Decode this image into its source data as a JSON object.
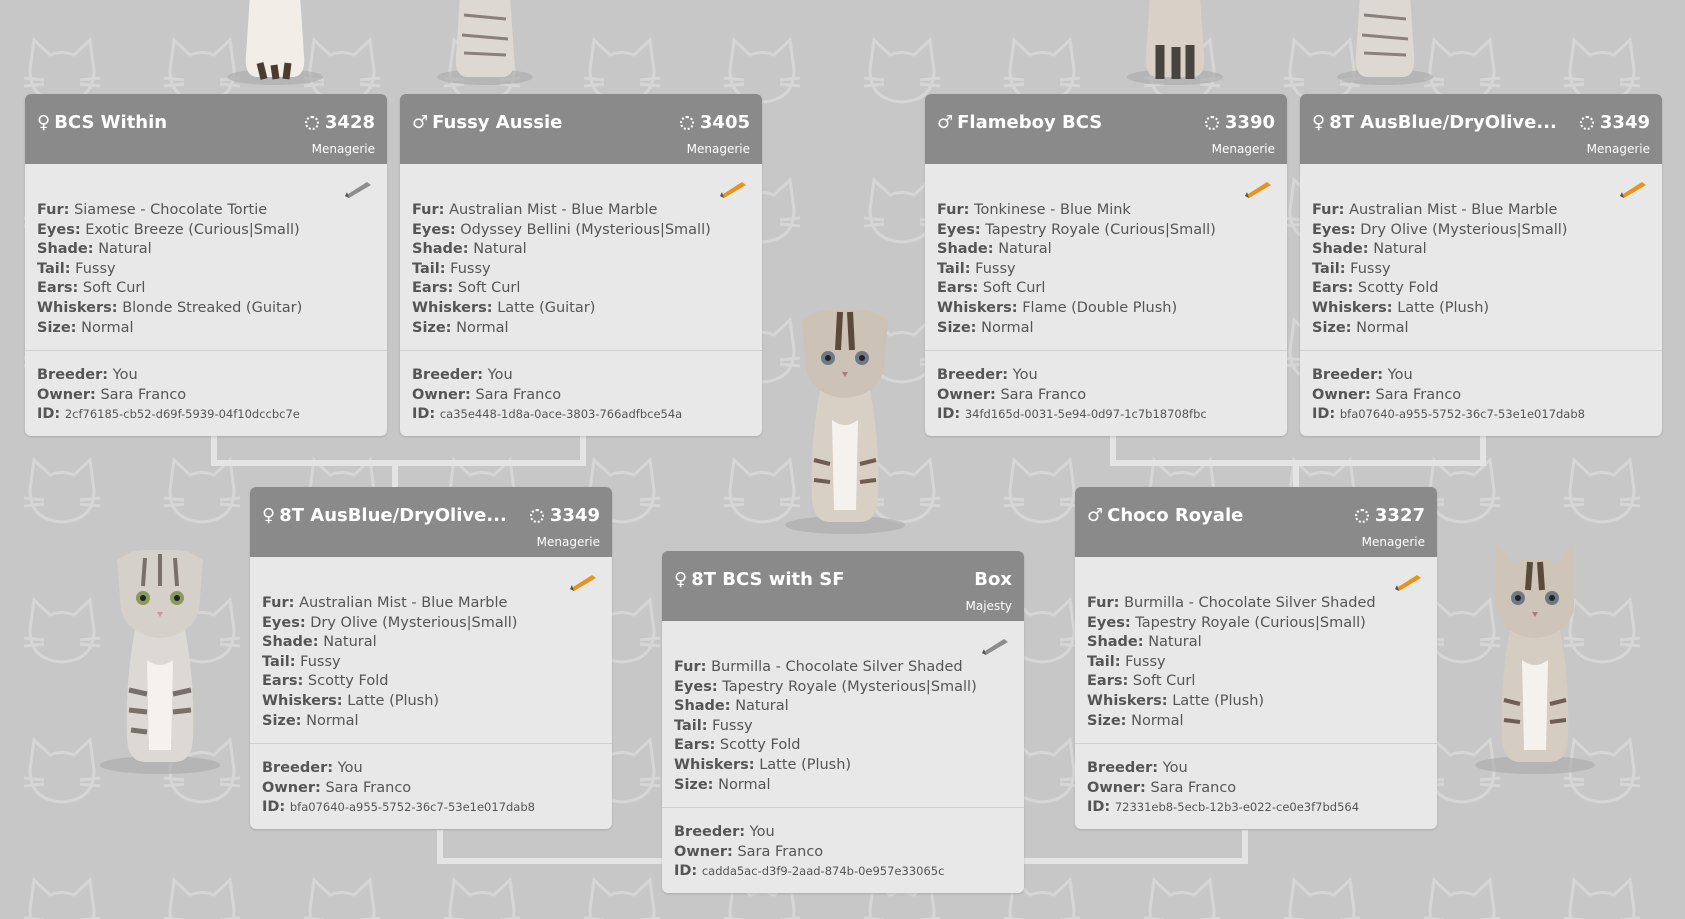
{
  "labels": {
    "fur": "Fur:",
    "eyes": "Eyes:",
    "shade": "Shade:",
    "tail": "Tail:",
    "ears": "Ears:",
    "whiskers": "Whiskers:",
    "size": "Size:",
    "breeder": "Breeder:",
    "owner": "Owner:",
    "id": "ID:"
  },
  "colors": {
    "background": "#c7c7c7",
    "card_header": "#8a8a8a",
    "card_body": "#e8e8e8",
    "pencil_orange": "#e8941a",
    "pencil_gray": "#8d8d8d"
  },
  "cats": [
    {
      "gender": "♀",
      "name": "BCS Within",
      "generation": "3428",
      "tag": "Menagerie",
      "fur": "Siamese - Chocolate Tortie",
      "eyes": "Exotic Breeze (Curious|Small)",
      "shade": "Natural",
      "tail": "Fussy",
      "ears": "Soft Curl",
      "whiskers": "Blonde Streaked (Guitar)",
      "size": "Normal",
      "breeder": "You",
      "owner": "Sara Franco",
      "id": "2cf76185-cb52-d69f-5939-04f10dccbc7e",
      "edit_icon": "pencil-gray-icon"
    },
    {
      "gender": "♂",
      "name": "Fussy Aussie",
      "generation": "3405",
      "tag": "Menagerie",
      "fur": "Australian Mist - Blue Marble",
      "eyes": "Odyssey Bellini (Mysterious|Small)",
      "shade": "Natural",
      "tail": "Fussy",
      "ears": "Soft Curl",
      "whiskers": "Latte (Guitar)",
      "size": "Normal",
      "breeder": "You",
      "owner": "Sara Franco",
      "id": "ca35e448-1d8a-0ace-3803-766adfbce54a",
      "edit_icon": "pencil-orange-icon"
    },
    {
      "gender": "♂",
      "name": "Flameboy BCS",
      "generation": "3390",
      "tag": "Menagerie",
      "fur": "Tonkinese - Blue Mink",
      "eyes": "Tapestry Royale (Curious|Small)",
      "shade": "Natural",
      "tail": "Fussy",
      "ears": "Soft Curl",
      "whiskers": "Flame (Double Plush)",
      "size": "Normal",
      "breeder": "You",
      "owner": "Sara Franco",
      "id": "34fd165d-0031-5e94-0d97-1c7b18708fbc",
      "edit_icon": "pencil-orange-icon"
    },
    {
      "gender": "♀",
      "name": "8T AusBlue/DryOlive...",
      "generation": "3349",
      "tag": "Menagerie",
      "fur": "Australian Mist - Blue Marble",
      "eyes": "Dry Olive (Mysterious|Small)",
      "shade": "Natural",
      "tail": "Fussy",
      "ears": "Scotty Fold",
      "whiskers": "Latte (Plush)",
      "size": "Normal",
      "breeder": "You",
      "owner": "Sara Franco",
      "id": "bfa07640-a955-5752-36c7-53e1e017dab8",
      "edit_icon": "pencil-orange-icon"
    },
    {
      "gender": "♀",
      "name": "8T AusBlue/DryOlive...",
      "generation": "3349",
      "tag": "Menagerie",
      "fur": "Australian Mist - Blue Marble",
      "eyes": "Dry Olive (Mysterious|Small)",
      "shade": "Natural",
      "tail": "Fussy",
      "ears": "Scotty Fold",
      "whiskers": "Latte (Plush)",
      "size": "Normal",
      "breeder": "You",
      "owner": "Sara Franco",
      "id": "bfa07640-a955-5752-36c7-53e1e017dab8",
      "edit_icon": "pencil-orange-icon"
    },
    {
      "gender": "♀",
      "name": "8T BCS with SF",
      "generation": "Box",
      "tag": "Majesty",
      "fur": "Burmilla - Chocolate Silver Shaded",
      "eyes": "Tapestry Royale (Mysterious|Small)",
      "shade": "Natural",
      "tail": "Fussy",
      "ears": "Scotty Fold",
      "whiskers": "Latte (Plush)",
      "size": "Normal",
      "breeder": "You",
      "owner": "Sara Franco",
      "id": "cadda5ac-d3f9-2aad-874b-0e957e33065c",
      "edit_icon": "pencil-gray-icon"
    },
    {
      "gender": "♂",
      "name": "Choco Royale",
      "generation": "3327",
      "tag": "Menagerie",
      "fur": "Burmilla - Chocolate Silver Shaded",
      "eyes": "Tapestry Royale (Curious|Small)",
      "shade": "Natural",
      "tail": "Fussy",
      "ears": "Soft Curl",
      "whiskers": "Latte (Plush)",
      "size": "Normal",
      "breeder": "You",
      "owner": "Sara Franco",
      "id": "72331eb8-5ecb-12b3-e022-ce0e3f7bd564",
      "edit_icon": "pencil-orange-icon"
    }
  ]
}
